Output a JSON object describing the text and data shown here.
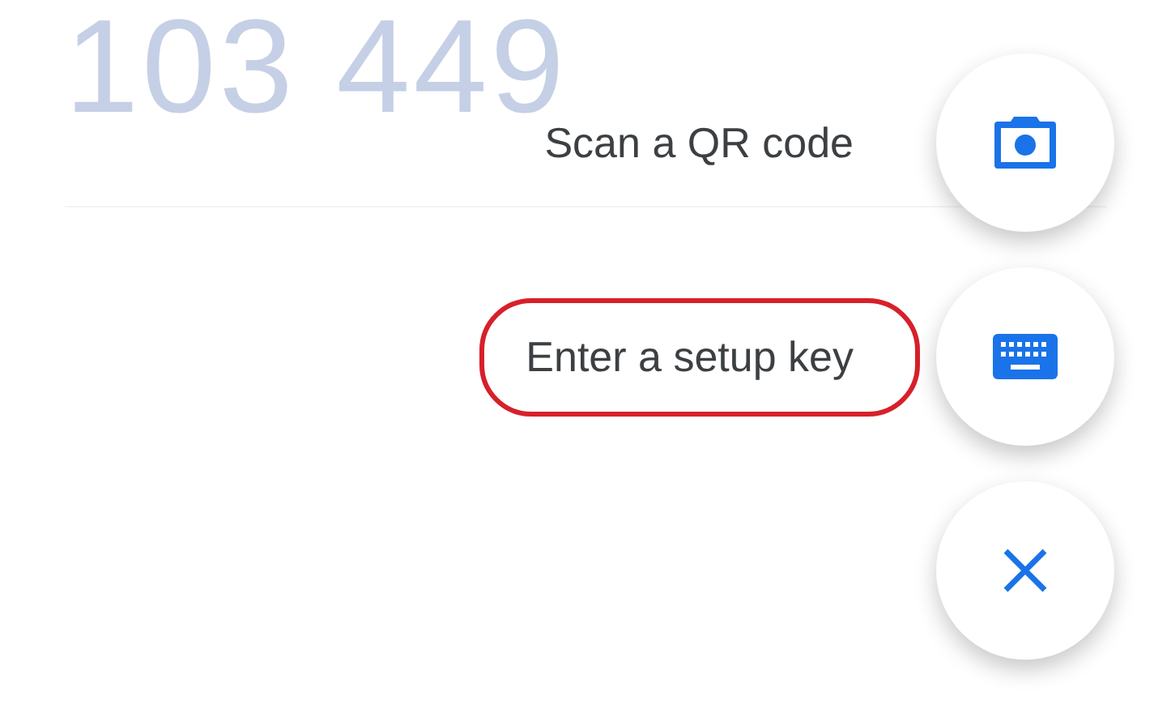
{
  "background_code": "103 449",
  "actions": [
    {
      "kind": "camera",
      "label": "Scan a QR code",
      "highlighted": false
    },
    {
      "kind": "keyboard",
      "label": "Enter a setup key",
      "highlighted": true
    }
  ],
  "close_button": {
    "kind": "close"
  }
}
